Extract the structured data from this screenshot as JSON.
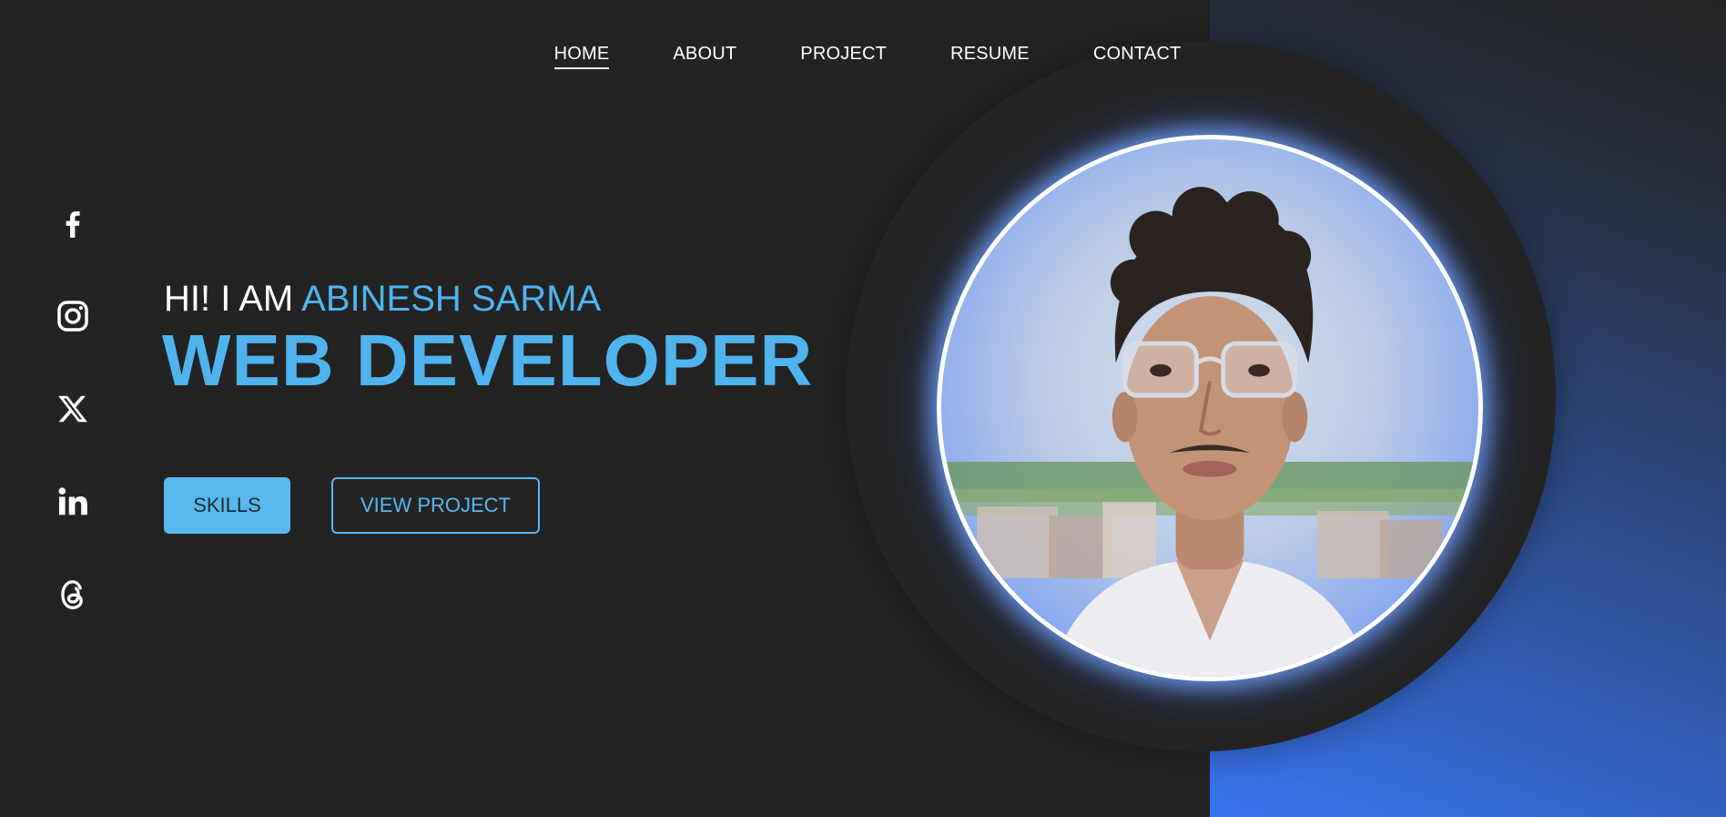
{
  "nav": {
    "items": [
      {
        "label": "HOME",
        "active": true
      },
      {
        "label": "ABOUT",
        "active": false
      },
      {
        "label": "PROJECT",
        "active": false
      },
      {
        "label": "RESUME",
        "active": false
      },
      {
        "label": "CONTACT",
        "active": false
      }
    ]
  },
  "social": [
    "facebook-icon",
    "instagram-icon",
    "x-icon",
    "linkedin-icon",
    "threads-icon"
  ],
  "hero": {
    "greeting": "HI! I AM",
    "name": "ABINESH SARMA",
    "role": "WEB DEVELOPER"
  },
  "buttons": {
    "skills": "SKILLS",
    "view_project": "VIEW PROJECT"
  },
  "colors": {
    "background": "#232323",
    "accent": "#4fb4ee",
    "gradient_end": "#3874ee"
  }
}
